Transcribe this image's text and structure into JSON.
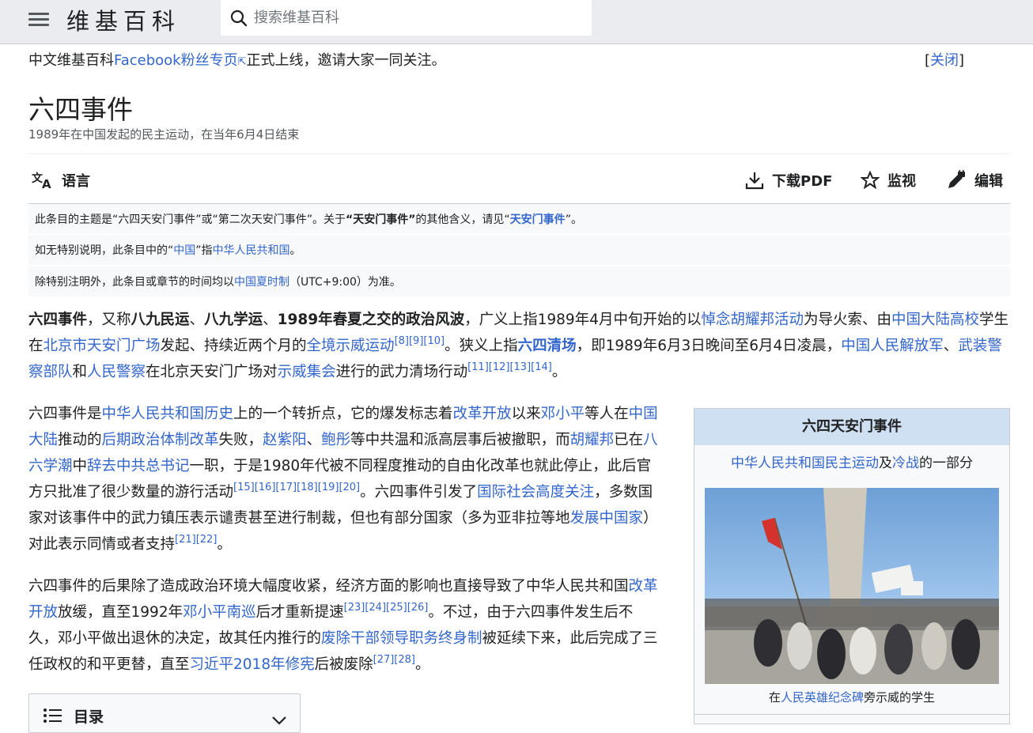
{
  "header": {
    "logo": "维基百科",
    "search_placeholder": "搜索维基百科"
  },
  "notice": {
    "text_before": "中文维基百科",
    "link": "Facebook粉丝专页",
    "text_after": "正式上线，邀请大家一同关注。",
    "close_label": "关闭"
  },
  "article": {
    "title": "六四事件",
    "subtitle": "1989年在中国发起的民主运动，在当年6月4日结束"
  },
  "tools": {
    "language": "语言",
    "download_pdf": "下载PDF",
    "watch": "监视",
    "edit": "编辑"
  },
  "hatnotes": [
    {
      "t1": "此条目的主题是“六四天安门事件”或“第二次天安门事件”。关于",
      "b1": "“天安门事件”",
      "t2": "的其他含义，请见“",
      "l1": "天安门事件",
      "t3": "”。"
    },
    {
      "t1": "如无特别说明，此条目中的“",
      "l1": "中国",
      "t2": "”指",
      "l2": "中华人民共和国",
      "t3": "。"
    },
    {
      "t1": " 除特别注明外，此条目或章节的时间均以",
      "l1": "中国夏时制",
      "t2": "（UTC+9:00）为准。"
    }
  ],
  "p1": {
    "b1": "六四事件",
    "t1": "，又称",
    "b2": "八九民运",
    "t2": "、",
    "b3": "八九学运",
    "t3": "、",
    "b4": "1989年春夏之交的政治风波",
    "t4": "，广义上指1989年4月中旬开始的以",
    "l1": "悼念胡耀邦活动",
    "t5": "为导火索、由",
    "l2": "中国大陆高校",
    "t6": "学生在",
    "l3": "北京市天安门广场",
    "t7": "发起、持续近两个月的",
    "l4": "全境示威运动",
    "r1": "[8][9][10]",
    "t8": "。狭义上指",
    "bl1": "六四清场",
    "t9": "，即1989年6月3日晚间至6月4日凌晨，",
    "l5": "中国人民解放军",
    "t10": "、",
    "l6": "武装警察部队",
    "t11": "和",
    "l7": "人民警察",
    "t12": "在北京天安门广场对",
    "l8": "示威集会",
    "t13": "进行的武力清场行动",
    "r2": "[11][12][13][14]",
    "t14": "。"
  },
  "p2": {
    "t1": "六四事件是",
    "l1": "中华人民共和国历史",
    "t2": "上的一个转折点，它的爆发标志着",
    "l2": "改革开放",
    "t3": "以来",
    "l3": "邓小平",
    "t4": "等人在",
    "l4": "中国大陆",
    "t5": "推动的",
    "l5": "后期政治体制改革",
    "t6": "失败，",
    "l6": "赵紫阳",
    "t7": "、",
    "l7": "鲍彤",
    "t8": "等中共温和派高层事后被撤职，而",
    "l8": "胡耀邦",
    "t9": "已在",
    "l9": "八六学潮",
    "t10": "中",
    "l10": "辞去中共总书记",
    "t11": "一职，于是1980年代被不同程度推动的自由化改革也就此停止，此后官方只批准了很少数量的游行活动",
    "r1": "[15][16][17][18][19][20]",
    "t12": "。六四事件引发了",
    "l11": "国际社会高度关注",
    "t13": "，多数国家对该事件中的武力镇压表示谴责甚至进行制裁，但也有部分国家（多为亚非拉等地",
    "l12": "发展中国家",
    "t14": "）对此表示同情或者支持",
    "r2": "[21][22]",
    "t15": "。"
  },
  "p3": {
    "t1": "六四事件的后果除了造成政治环境大幅度收紧，经济方面的影响也直接导致了中华人民共和国",
    "l1": "改革开放",
    "t2": "放缓，直至1992年",
    "l2": "邓小平南巡",
    "t3": "后才重新提速",
    "r1": "[23][24][25][26]",
    "t4": "。不过，由于六四事件发生后不久，邓小平做出退休的决定，故其任内推行的",
    "l3": "废除干部领导职务终身制",
    "t5": "被延续下来，此后完成了三任政权的和平更替，直至",
    "l4": "习近平2018年修宪",
    "t6": "后被废除",
    "r2": "[27][28]",
    "t7": "。"
  },
  "infobox": {
    "title": "六四天安门事件",
    "sub_l1": "中华人民共和国民主运动",
    "sub_t1": "及",
    "sub_l2": "冷战",
    "sub_t2": "的一部分",
    "caption_t1": "在",
    "caption_l1": "人民英雄纪念碑",
    "caption_t2": "旁示威的学生"
  },
  "toc": {
    "label": "目录"
  }
}
